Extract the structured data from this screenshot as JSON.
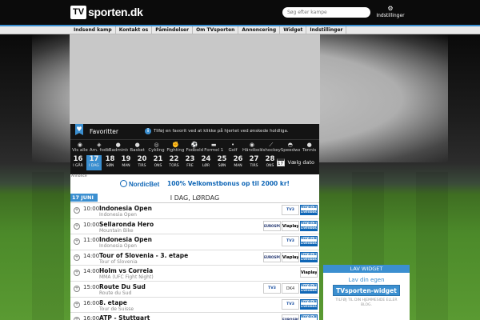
{
  "header": {
    "logo_tv": "TV",
    "logo_text": "sporten.dk",
    "search_placeholder": "Søg efter kampe",
    "settings_label": "Indstillinger"
  },
  "nav": [
    "Indsend kamp",
    "Kontakt os",
    "Påmindelser",
    "Om TVsporten",
    "Annoncering",
    "Widget",
    "Indstillinger"
  ],
  "favorites": {
    "title": "Favoritter",
    "info": "i",
    "hint": "Tilføj en favorit ved at klikke på hjertet ved ønskede holdliga."
  },
  "sports": [
    {
      "icon": "all-icon",
      "glyph": "◉",
      "label": "Vis alle"
    },
    {
      "icon": "football-icon",
      "glyph": "◈",
      "label": "Am. fodbold"
    },
    {
      "icon": "badminton-icon",
      "glyph": "●",
      "label": "Badminton"
    },
    {
      "icon": "basketball-icon",
      "glyph": "●",
      "label": "Basket"
    },
    {
      "icon": "cycling-icon",
      "glyph": "◎",
      "label": "Cykling"
    },
    {
      "icon": "fighting-icon",
      "glyph": "✊",
      "label": "Fighting"
    },
    {
      "icon": "soccer-icon",
      "glyph": "⚽",
      "label": "Fodbold"
    },
    {
      "icon": "formula1-icon",
      "glyph": "▬",
      "label": "Formel 1"
    },
    {
      "icon": "golf-icon",
      "glyph": "•",
      "label": "Golf"
    },
    {
      "icon": "handball-icon",
      "glyph": "◉",
      "label": "Håndbold"
    },
    {
      "icon": "icehockey-icon",
      "glyph": "⟋",
      "label": "Ishockey"
    },
    {
      "icon": "speedway-icon",
      "glyph": "◓",
      "label": "Speedway"
    },
    {
      "icon": "tennis-icon",
      "glyph": "●",
      "label": "Tennis"
    }
  ],
  "dates": [
    {
      "d": "16",
      "w": "I GÅR",
      "active": false
    },
    {
      "d": "17",
      "w": "I DAG",
      "active": true
    },
    {
      "d": "18",
      "w": "SØN",
      "active": false
    },
    {
      "d": "19",
      "w": "MAN",
      "active": false
    },
    {
      "d": "20",
      "w": "TIRS",
      "active": false
    },
    {
      "d": "21",
      "w": "ONS",
      "active": false
    },
    {
      "d": "22",
      "w": "TORS",
      "active": false
    },
    {
      "d": "23",
      "w": "FRE",
      "active": false
    },
    {
      "d": "24",
      "w": "LØR",
      "active": false
    },
    {
      "d": "25",
      "w": "SØN",
      "active": false
    },
    {
      "d": "26",
      "w": "MAN",
      "active": false
    },
    {
      "d": "27",
      "w": "TIRS",
      "active": false
    },
    {
      "d": "28",
      "w": "ONS",
      "active": false
    }
  ],
  "pick_date": {
    "cal_day": "17",
    "label": "Vælg dato"
  },
  "ad": {
    "label": "Annonce",
    "brand": "NordicBet",
    "promo": "100% Velkomstbonus op til 2000 kr!"
  },
  "list": {
    "date_tag": "17 JUNI",
    "day_label": "I DAG, LØRDAG",
    "events": [
      {
        "time": "10:00",
        "title": "Indonesia Open",
        "sub": "Indonesia Open",
        "icon": "badminton-icon",
        "chans": [
          "tv",
          "nb"
        ]
      },
      {
        "time": "10:00",
        "title": "Sellaronda Hero",
        "sub": "Mountain Bike",
        "icon": "cycling-icon",
        "chans": [
          "eu",
          "vp",
          "nb"
        ]
      },
      {
        "time": "11:00",
        "title": "Indonesia Open",
        "sub": "Indonesia Open",
        "icon": "badminton-icon",
        "chans": [
          "tv",
          "nb"
        ]
      },
      {
        "time": "14:00",
        "title": "Tour of Slovenia - 3. etape",
        "sub": "Tour of Slovenia",
        "icon": "cycling-icon",
        "chans": [
          "eu",
          "vp",
          "nb"
        ]
      },
      {
        "time": "14:00",
        "title": "Holm vs Correia",
        "sub": "MMA (UFC Fight Night)",
        "icon": "fighting-icon",
        "chans": [
          "vp"
        ]
      },
      {
        "time": "15:00",
        "title": "Route Du Sud",
        "sub": "Route du Sud",
        "icon": "cycling-icon",
        "chans": [
          "tv",
          "dk",
          "nb"
        ]
      },
      {
        "time": "16:00",
        "title": "8. etape",
        "sub": "Tour de Suisse",
        "icon": "cycling-icon",
        "chans": [
          "tv",
          "nb"
        ]
      },
      {
        "time": "16:00",
        "title": "ATP - Stuttgart",
        "sub": "",
        "icon": "tennis-icon",
        "chans": [
          "eu",
          "nb"
        ]
      }
    ]
  },
  "channels": {
    "tv": "TV3 SPORT",
    "eu": "EUROSPORT",
    "dk": "DK4",
    "vp": "Viaplay",
    "nb_top": "NordicBet",
    "nb_bottom": "LIVEODDS"
  },
  "widget": {
    "head": "LAV WIDGET",
    "sub": "Lav din egen",
    "button": "TVsporten-widget",
    "note": "TILFØJ TIL DIN HJEMMESIDE ELLER BLOG."
  },
  "colors": {
    "accent": "#3b8fd0",
    "nordicbet": "#0f66b6"
  }
}
